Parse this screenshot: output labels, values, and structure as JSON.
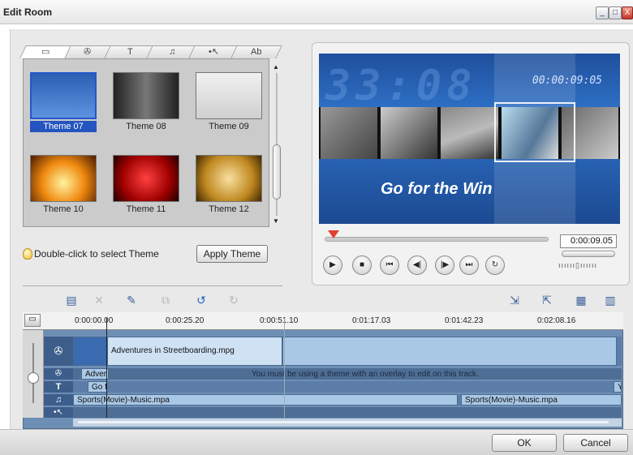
{
  "window": {
    "title": "Edit Room",
    "minimize": "_",
    "maximize": "□",
    "close": "X"
  },
  "tabs": [
    {
      "icon": "▭",
      "name": "video-tab"
    },
    {
      "icon": "✇",
      "name": "theme-tab"
    },
    {
      "icon": "T",
      "name": "title-tab"
    },
    {
      "icon": "♫",
      "name": "music-tab"
    },
    {
      "icon": "•↖",
      "name": "effects-tab"
    },
    {
      "icon": "Ab",
      "name": "text-effects-tab"
    }
  ],
  "themes": [
    {
      "label": "Theme 07",
      "selected": true
    },
    {
      "label": "Theme 08"
    },
    {
      "label": "Theme 09"
    },
    {
      "label": "Theme 10"
    },
    {
      "label": "Theme 11"
    },
    {
      "label": "Theme 12"
    }
  ],
  "hint": "Double-click to select Theme",
  "apply_label": "Apply Theme",
  "preview": {
    "big_time": "33:08",
    "small_time": "00:00:09:05",
    "slogan": "Go for the Win",
    "timecode": "0:00:09.05",
    "scrub_position": 0.04
  },
  "controls": [
    "▶",
    "■",
    "⏮",
    "◀|",
    "|▶",
    "⏭",
    "↻"
  ],
  "ruler_ticks": [
    "0:00:00.00",
    "0:00:25.20",
    "0:00:51.10",
    "0:01:17.03",
    "0:01:42.23",
    "0:02:08.16"
  ],
  "tracks": {
    "video_clip": "Adventures in Streetboarding.mpg",
    "overlay_clip": "Adver",
    "overlay_msg": "You must be using a theme with an overlay to edit on this track.",
    "title_clip": "Go f",
    "title_end": "Y",
    "music_clip_1": "Sports(Movie)-Music.mpa",
    "music_clip_2": "Sports(Movie)-Music.mpa"
  },
  "footer": {
    "ok": "OK",
    "cancel": "Cancel"
  }
}
